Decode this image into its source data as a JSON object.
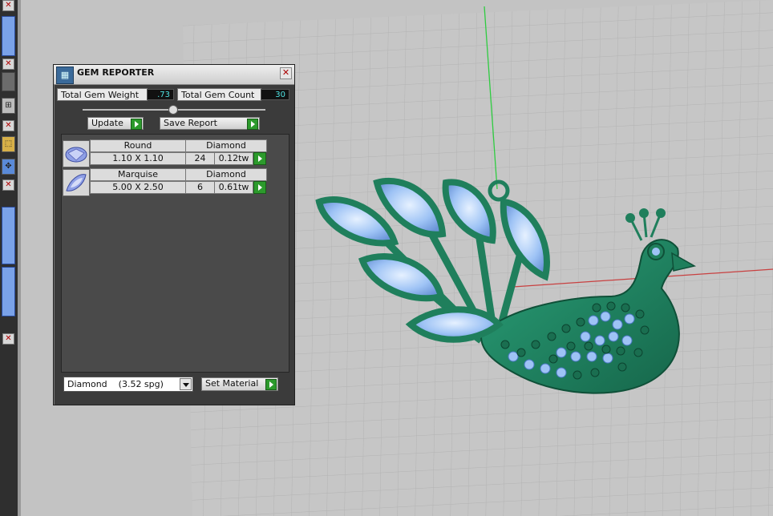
{
  "panel": {
    "title": "GEM REPORTER",
    "total_weight_label": "Total Gem Weight",
    "total_weight_value": ".73",
    "total_count_label": "Total Gem Count",
    "total_count_value": "30",
    "update_label": "Update",
    "save_report_label": "Save Report",
    "close_glyph": "✕"
  },
  "gems": [
    {
      "shape": "Round",
      "size": "1.10 X 1.10",
      "material": "Diamond",
      "count": "24",
      "weight": "0.12tw",
      "icon": "round-gem-icon"
    },
    {
      "shape": "Marquise",
      "size": "5.00 X 2.50",
      "material": "Diamond",
      "count": "6",
      "weight": "0.61tw",
      "icon": "marquise-gem-icon"
    }
  ],
  "material": {
    "selected": "Diamond    (3.52 spg)",
    "set_material_label": "Set Material"
  },
  "colors": {
    "model_green": "#1f7f5c",
    "gem_blue": "#9ec3f5",
    "value_cyan": "#4fe3e3",
    "arrow_green": "#2c9a2c"
  }
}
